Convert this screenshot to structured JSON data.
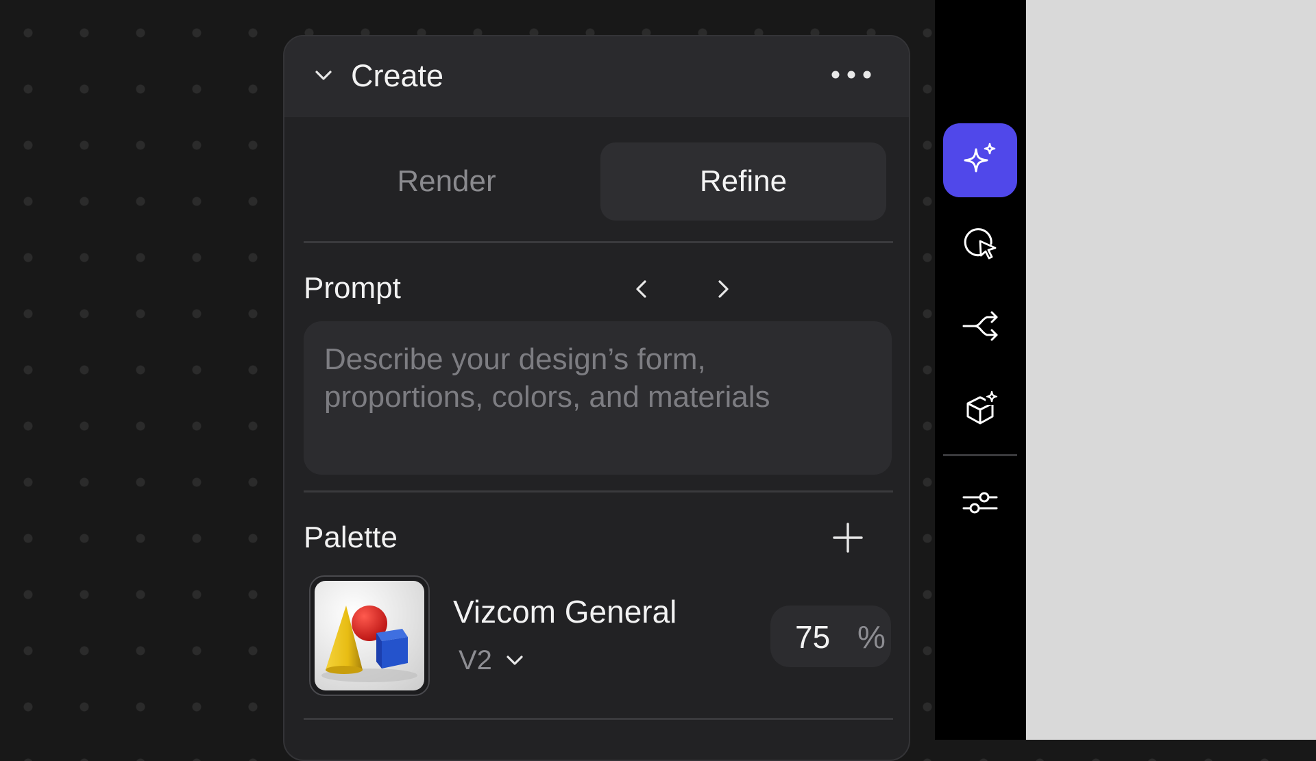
{
  "panel": {
    "title": "Create",
    "tabs": [
      {
        "label": "Render",
        "selected": false
      },
      {
        "label": "Refine",
        "selected": true
      }
    ],
    "prompt": {
      "label": "Prompt",
      "placeholder": "Describe your design’s form, proportions, colors, and materials",
      "describe_label": "Describe"
    },
    "palette": {
      "label": "Palette",
      "item": {
        "name": "Vizcom General",
        "version": "V2",
        "strength_value": "75",
        "strength_unit": "%"
      }
    }
  },
  "sidebar": {
    "tools": [
      {
        "icon": "sparkle-icon",
        "active": true
      },
      {
        "icon": "cursor-select-icon",
        "active": false
      },
      {
        "icon": "branch-icon",
        "active": false
      },
      {
        "icon": "cube-sparkle-icon",
        "active": false
      },
      {
        "icon": "sliders-icon",
        "active": false
      }
    ]
  },
  "colors": {
    "accent": "#5048ea",
    "link": "#7b78f0",
    "panel_bg": "#222224",
    "canvas_bg": "#181818"
  }
}
